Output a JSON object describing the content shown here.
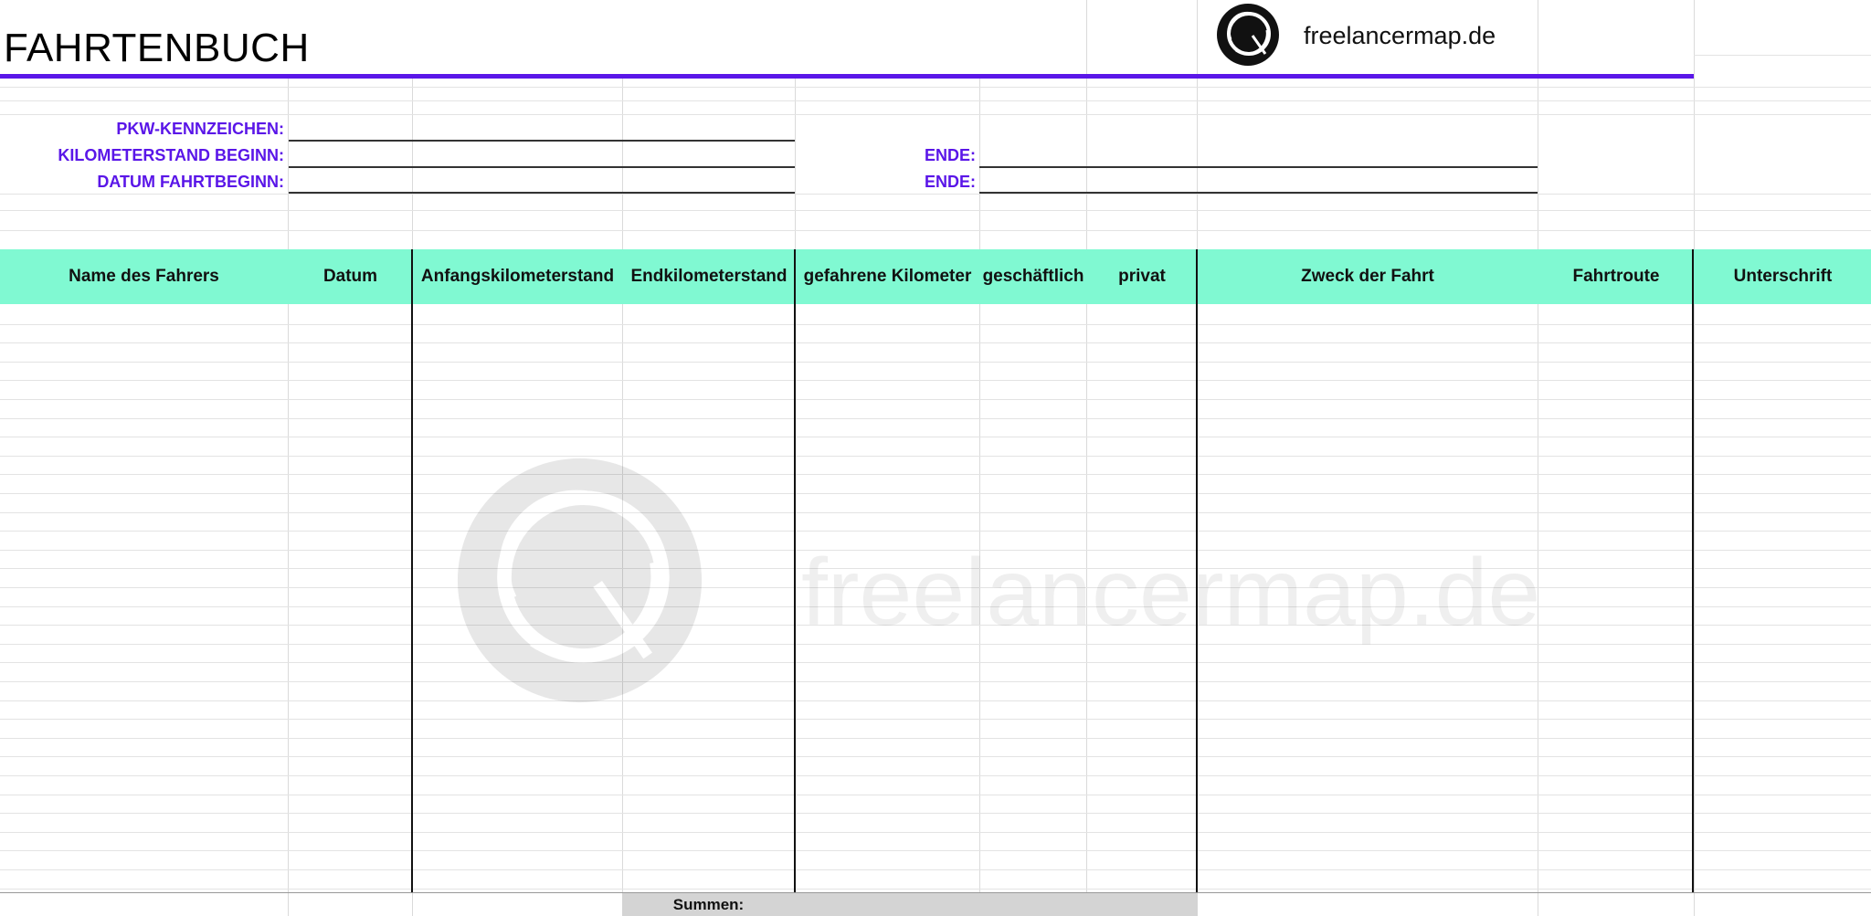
{
  "sheet": {
    "title": "FAHRTENBUCH",
    "brand": "freelancermap.de",
    "watermark_text": "freelancermap.de"
  },
  "fields": {
    "plate_label": "PKW-KENNZEICHEN:",
    "km_start_label": "KILOMETERSTAND BEGINN:",
    "km_end_label": "ENDE:",
    "date_start_label": "DATUM FAHRTBEGINN:",
    "date_end_label": "ENDE:",
    "plate_value": "",
    "km_start_value": "",
    "km_end_value": "",
    "date_start_value": "",
    "date_end_value": ""
  },
  "table": {
    "columns": [
      "Name des Fahrers",
      "Datum",
      "Anfangskilometerstand",
      "Endkilometerstand",
      "gefahrene Kilometer",
      "geschäftlich",
      "privat",
      "Zweck der Fahrt",
      "Fahrtroute",
      "Unterschrift"
    ],
    "rows": [],
    "sums_label": "Summen:"
  },
  "colors": {
    "accent": "#5a16e8",
    "header_bg": "#80f9d2",
    "sums_bg": "#d4d4d4"
  },
  "icons": {
    "logo": "freelancermap-globe-icon"
  }
}
